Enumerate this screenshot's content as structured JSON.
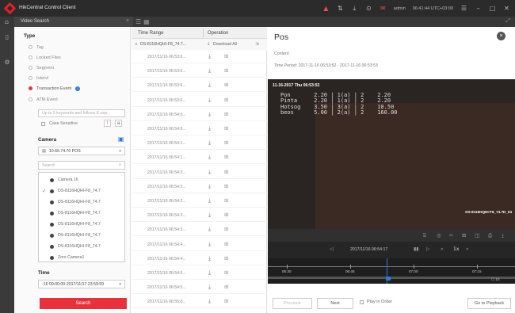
{
  "window": {
    "title": "HikCentral Control Client",
    "user": "admin",
    "datetime": "06:41:44 UTC+03:00"
  },
  "tab": {
    "label": "Video Search"
  },
  "search": {
    "type_title": "Type",
    "types": [
      {
        "label": "Tag",
        "selected": false
      },
      {
        "label": "Locked Files",
        "selected": false
      },
      {
        "label": "Segment",
        "selected": false
      },
      {
        "label": "Intervl",
        "selected": false
      },
      {
        "label": "Transaction Event",
        "selected": true
      },
      {
        "label": "ATM Event",
        "selected": false
      }
    ],
    "keyword_placeholder": "Up to 5 keywords and follows E.sep...",
    "case_sensitive": "Case Sensitive",
    "camera_title": "Camera",
    "camera_select": "10.66.74.70 POS",
    "camera_search_placeholder": "Search",
    "cameras": [
      {
        "label": "Camera 16",
        "checked": false
      },
      {
        "label": "DS-8116HQHI-F8_74.7",
        "checked": true
      },
      {
        "label": "DS-8116HQHI-F8_74.7",
        "checked": false
      },
      {
        "label": "DS-8116HQHI-F8_74.7",
        "checked": false
      },
      {
        "label": "DS-8116HQHI-F8_74.7",
        "checked": false
      },
      {
        "label": "DS-8116HQHI-F8_74.7",
        "checked": false
      },
      {
        "label": "DS-8116HQHI-F8_74.7",
        "checked": false
      },
      {
        "label": "Zoro Camera1",
        "checked": false
      }
    ],
    "time_title": "Time",
    "time_value": "-16 00:00:00-2017/11/17 23:59:59",
    "search_button": "Search"
  },
  "results": {
    "col_time": "Time Range",
    "col_operation": "Operation",
    "group_name": "DS-8116HQHI-F8_74.7...",
    "download_all": "Download All",
    "rows": [
      "2017/11/16 06:53:6...",
      "2017/11/16 06:53:6...",
      "2017/11/16 06:53:6...",
      "2017/11/16 06:53:6...",
      "2017/11/16 06:54:0...",
      "2017/11/16 06:54:0...",
      "2017/11/16 06:54:1...",
      "2017/11/16 06:54:1...",
      "2017/11/16 06:54:2...",
      "2017/11/16 06:54:2...",
      "2017/11/16 06:54:2...",
      "2017/11/16 06:54:3...",
      "2017/11/16 06:54:3...",
      "2017/11/16 06:54:4...",
      "2017/11/16 06:54:4...",
      "2017/11/16 06:54:5...",
      "2017/11/16 06:54:5...",
      "2017/11/16 06:55:0..."
    ]
  },
  "detail": {
    "title": "Pos",
    "content_label": "Content:",
    "time_period": "Time Period:  2017-11-16 06:53:52 - 2017-11-16 06:53:53",
    "video_timestamp": "11-16-2017 Thu 06:53:52",
    "pos_text": "Pon       2.20 | 1(a) | 2    2.20\nPinta     2.20 | 1(a) | 2    2.20\nHotsog    3.50 | 3(a) | 2    10.50\nbeos      5.00 | 2(a) | 2    160.00",
    "channel_label": "DS-8116HQHI-F8_74.7D_04",
    "playback_time": "2017/11/16 06:54:17",
    "speed": "1x",
    "timeline_labels": [
      "06:30",
      "06:45",
      "07:00",
      "07:15"
    ],
    "checkbox_1h": "1h",
    "previous": "Previous",
    "next": "Next",
    "play_in_order": "Play in Order",
    "go_to_playback": "Go to Playback"
  }
}
